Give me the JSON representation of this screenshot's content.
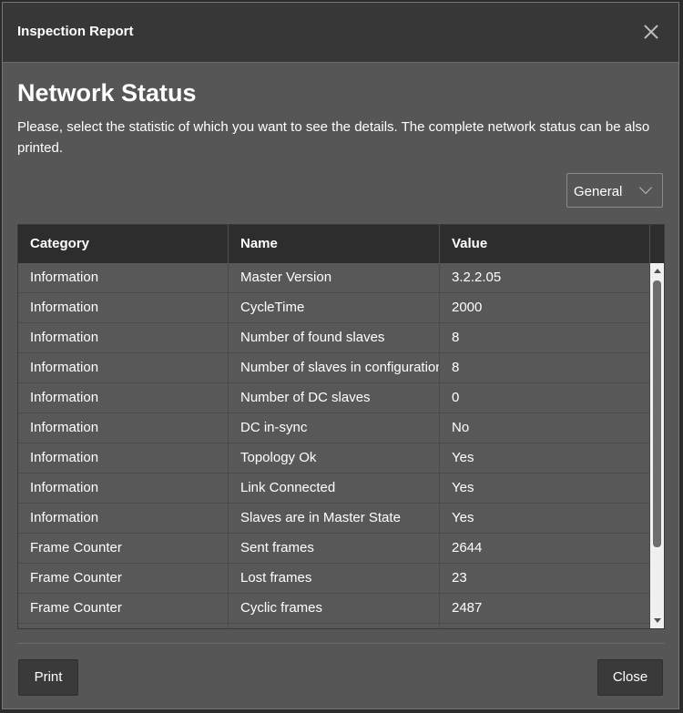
{
  "dialog": {
    "title": "Inspection Report",
    "close_icon": "close-icon"
  },
  "header": {
    "heading": "Network Status",
    "description": "Please, select the statistic of which you want to see the details. The complete network status can be also printed."
  },
  "filter": {
    "selected": "General",
    "icon": "chevron-down-icon"
  },
  "table": {
    "columns": [
      "Category",
      "Name",
      "Value"
    ],
    "rows": [
      [
        "Information",
        "Master Version",
        "3.2.2.05"
      ],
      [
        "Information",
        "CycleTime",
        "2000"
      ],
      [
        "Information",
        "Number of found slaves",
        "8"
      ],
      [
        "Information",
        "Number of slaves in configuration",
        "8"
      ],
      [
        "Information",
        "Number of DC slaves",
        "0"
      ],
      [
        "Information",
        "DC in-sync",
        "No"
      ],
      [
        "Information",
        "Topology Ok",
        "Yes"
      ],
      [
        "Information",
        "Link Connected",
        "Yes"
      ],
      [
        "Information",
        "Slaves are in Master State",
        "Yes"
      ],
      [
        "Frame Counter",
        "Sent frames",
        "2644"
      ],
      [
        "Frame Counter",
        "Lost frames",
        "23"
      ],
      [
        "Frame Counter",
        "Cyclic frames",
        "2487"
      ],
      [
        "",
        "",
        ""
      ]
    ]
  },
  "footer": {
    "print_label": "Print",
    "close_label": "Close"
  }
}
